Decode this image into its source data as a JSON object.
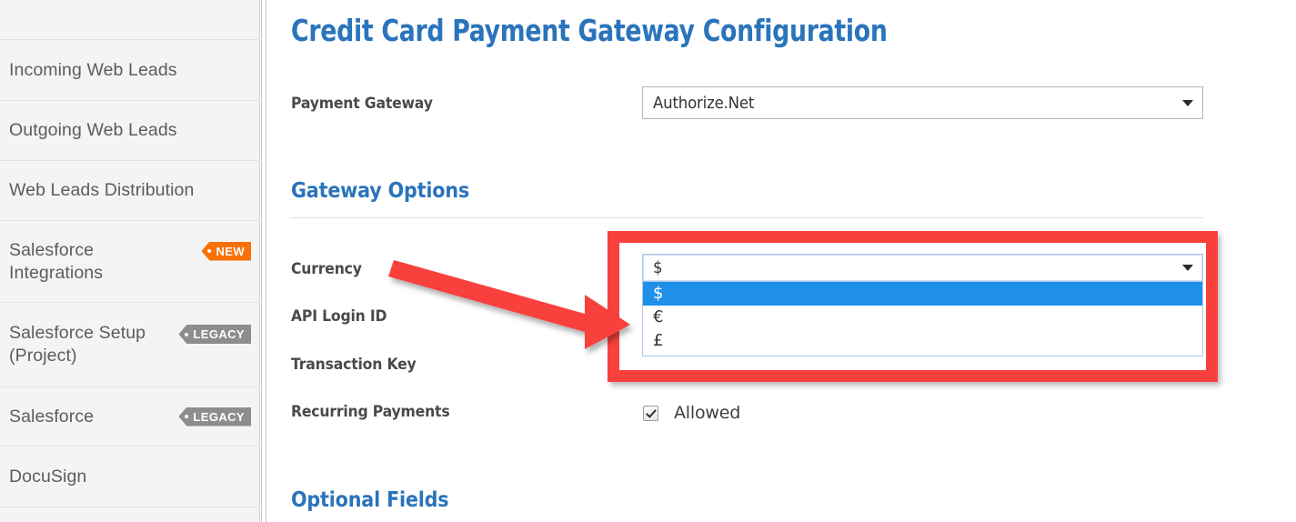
{
  "sidebar": {
    "items": [
      {
        "label": "Incoming Web Leads",
        "badge": null,
        "badge_type": null
      },
      {
        "label": "Outgoing Web Leads",
        "badge": null,
        "badge_type": null
      },
      {
        "label": "Web Leads Distribution",
        "badge": null,
        "badge_type": null
      },
      {
        "label": "Salesforce\nIntegrations",
        "badge": "NEW",
        "badge_type": "new"
      },
      {
        "label": "Salesforce Setup\n(Project)",
        "badge": "LEGACY",
        "badge_type": "legacy"
      },
      {
        "label": "Salesforce",
        "badge": "LEGACY",
        "badge_type": "legacy"
      },
      {
        "label": "DocuSign",
        "badge": null,
        "badge_type": null
      }
    ]
  },
  "content": {
    "page_title": "Credit Card Payment Gateway Configuration",
    "payment_gateway": {
      "label": "Payment Gateway",
      "value": "Authorize.Net"
    },
    "gateway_options": {
      "heading": "Gateway Options",
      "currency": {
        "label": "Currency",
        "value": "$",
        "options": [
          "$",
          "€",
          "£"
        ],
        "selected_index": 0,
        "expanded": true
      },
      "api_login_id": {
        "label": "API Login ID"
      },
      "transaction_key": {
        "label": "Transaction Key"
      },
      "recurring_payments": {
        "label": "Recurring Payments",
        "checkbox_label": "Allowed",
        "checked": true
      }
    },
    "optional_fields": {
      "heading": "Optional Fields"
    }
  },
  "annotations": {
    "highlight_color": "#f8413d",
    "arrow_color": "#f8413d",
    "target": "currency-dropdown"
  },
  "colors": {
    "heading_blue": "#2a74bb",
    "badge_new_orange": "#f97105",
    "badge_legacy_gray": "#8d8d8d",
    "dropdown_highlight_blue": "#1e90e8",
    "annotation_red": "#f8413d",
    "sidebar_background": "#f4f4f4"
  }
}
